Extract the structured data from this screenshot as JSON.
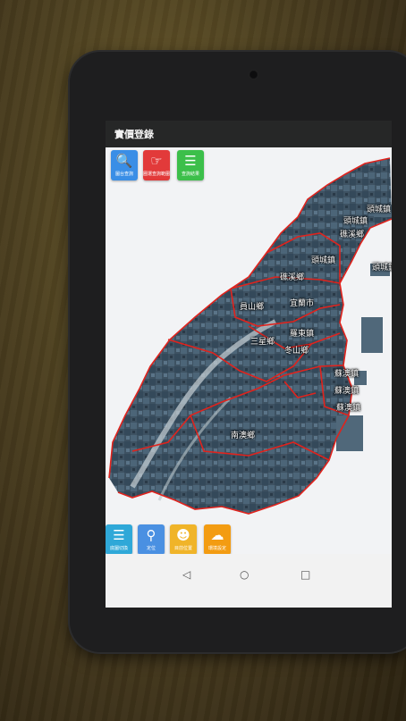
{
  "app": {
    "title": "實價登錄"
  },
  "top_toolbar": [
    {
      "label": "圖台查詢",
      "icon": "magnifier-icon",
      "color": "#3a8ee6"
    },
    {
      "label": "圈選查詢範圍",
      "icon": "hand-pointer-icon",
      "color": "#e23a3a"
    },
    {
      "label": "查詢結果",
      "icon": "list-icon",
      "color": "#3cbf4a"
    }
  ],
  "bottom_toolbar": [
    {
      "label": "底圖切換",
      "icon": "layers-icon",
      "color": "#2fa8d8"
    },
    {
      "label": "定位",
      "icon": "location-pin-icon",
      "color": "#4a90e2"
    },
    {
      "label": "目前位置",
      "icon": "person-icon",
      "color": "#f0b429"
    },
    {
      "label": "環境設定",
      "icon": "cloud-icon",
      "color": "#f39c12"
    }
  ],
  "places": [
    "頭城鎮",
    "頭城鎮",
    "礁溪鄉",
    "頭城鎮",
    "頭城鎮",
    "礁溪鄉",
    "員山鄉",
    "宜蘭市",
    "三星鄉",
    "羅東鎮",
    "冬山鄉",
    "蘇澳鎮",
    "蘇澳鎮",
    "蘇澳鎮",
    "南澳鄉"
  ],
  "nav": {
    "back": "◁",
    "home": "○",
    "recents": "□"
  }
}
